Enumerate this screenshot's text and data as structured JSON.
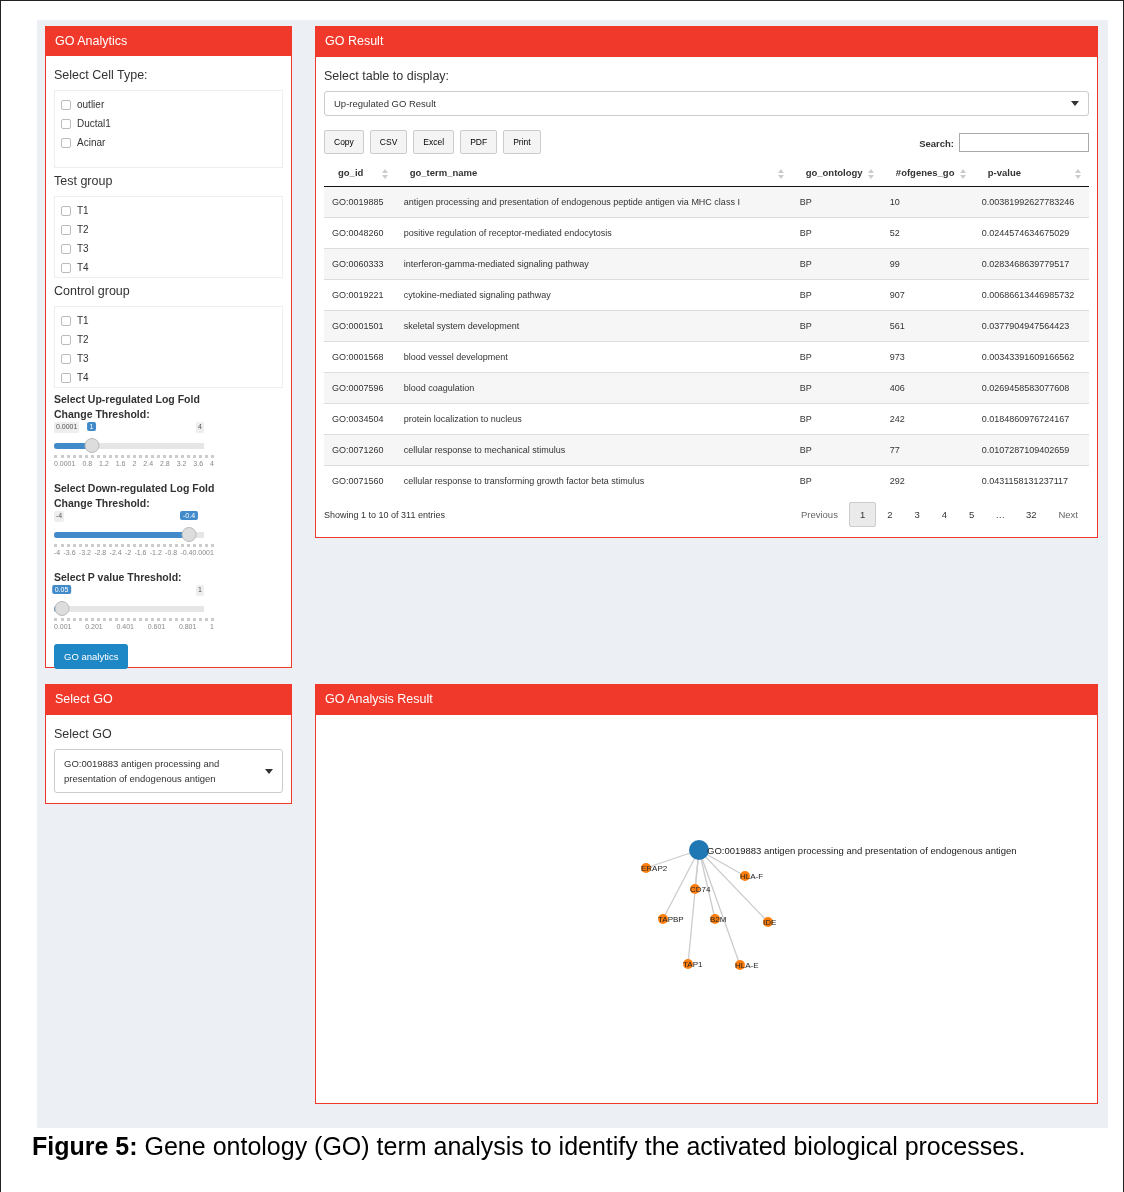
{
  "go_analytics": {
    "title": "GO Analytics",
    "cell_type": {
      "label": "Select Cell Type:",
      "options": [
        {
          "label": "outlier",
          "checked": false
        },
        {
          "label": "Ductal1",
          "checked": false
        },
        {
          "label": "Acinar",
          "checked": false
        }
      ]
    },
    "test_group": {
      "label": "Test group",
      "options": [
        {
          "label": "T1",
          "checked": false
        },
        {
          "label": "T2",
          "checked": false
        },
        {
          "label": "T3",
          "checked": false
        },
        {
          "label": "T4",
          "checked": false
        }
      ]
    },
    "control_group": {
      "label": "Control group",
      "options": [
        {
          "label": "T1",
          "checked": false
        },
        {
          "label": "T2",
          "checked": false
        },
        {
          "label": "T3",
          "checked": false
        },
        {
          "label": "T4",
          "checked": false
        }
      ]
    },
    "sliders": [
      {
        "label": "Select Up-regulated Log Fold Change Threshold:",
        "min_label": "0.0001",
        "max_label": "4",
        "value_label": "1",
        "level": 0.25,
        "ticks": [
          "0.0001",
          "0.8",
          "1.2",
          "1.6",
          "2",
          "2.4",
          "2.8",
          "3.2",
          "3.6",
          "4"
        ]
      },
      {
        "label": "Select Down-regulated Log Fold Change Threshold:",
        "min_label": "-4",
        "value_label": "-0.4",
        "level": 0.9,
        "ticks": [
          "-4",
          "-3.6",
          "-3.2",
          "-2.8",
          "-2.4",
          "-2",
          "-1.6",
          "-1.2",
          "-0.8",
          "-0.40.0001"
        ]
      },
      {
        "label": "Select P value Threshold:",
        "max_label": "1",
        "value_label": "0.05",
        "level": 0.05,
        "ticks": [
          "0.001",
          "0.201",
          "0.401",
          "0.601",
          "0.801",
          "1"
        ]
      }
    ],
    "button": "GO analytics"
  },
  "go_result": {
    "title": "GO Result",
    "select_label": "Select table to display:",
    "select_value": "Up-regulated GO Result",
    "export_buttons": [
      "Copy",
      "CSV",
      "Excel",
      "PDF",
      "Print"
    ],
    "search_label": "Search:",
    "table": {
      "columns": [
        "go_id",
        "go_term_name",
        "go_ontology",
        "#ofgenes_go",
        "p-value"
      ],
      "rows": [
        [
          "GO:0019885",
          "antigen processing and presentation of endogenous peptide antigen via MHC class I",
          "BP",
          "10",
          "0.00381992627783246"
        ],
        [
          "GO:0048260",
          "positive regulation of receptor-mediated endocytosis",
          "BP",
          "52",
          "0.0244574634675029"
        ],
        [
          "GO:0060333",
          "interferon-gamma-mediated signaling pathway",
          "BP",
          "99",
          "0.0283468639779517"
        ],
        [
          "GO:0019221",
          "cytokine-mediated signaling pathway",
          "BP",
          "907",
          "0.00686613446985732"
        ],
        [
          "GO:0001501",
          "skeletal system development",
          "BP",
          "561",
          "0.0377904947564423"
        ],
        [
          "GO:0001568",
          "blood vessel development",
          "BP",
          "973",
          "0.00343391609166562"
        ],
        [
          "GO:0007596",
          "blood coagulation",
          "BP",
          "406",
          "0.0269458583077608"
        ],
        [
          "GO:0034504",
          "protein localization to nucleus",
          "BP",
          "242",
          "0.0184860976724167"
        ],
        [
          "GO:0071260",
          "cellular response to mechanical stimulus",
          "BP",
          "77",
          "0.0107287109402659"
        ],
        [
          "GO:0071560",
          "cellular response to transforming growth factor beta stimulus",
          "BP",
          "292",
          "0.0431158131237117"
        ]
      ]
    },
    "info": "Showing 1 to 10 of 311 entries",
    "pagination": [
      {
        "label": "Previous",
        "kind": "nav"
      },
      {
        "label": "1",
        "kind": "page",
        "selected": true
      },
      {
        "label": "2",
        "kind": "page",
        "selected": false
      },
      {
        "label": "3",
        "kind": "page",
        "selected": false
      },
      {
        "label": "4",
        "kind": "page",
        "selected": false
      },
      {
        "label": "5",
        "kind": "page",
        "selected": false
      },
      {
        "label": "…",
        "kind": "gap"
      },
      {
        "label": "32",
        "kind": "page",
        "selected": false
      },
      {
        "label": "Next",
        "kind": "nav"
      }
    ]
  },
  "select_go": {
    "title": "Select GO",
    "label": "Select GO",
    "value": "GO:0019883 antigen processing and presentation of endogenous antigen"
  },
  "analysis_result": {
    "title": "GO Analysis Result",
    "network": {
      "center": "GO:0019883 antigen processing and presentation of endogenous antigen",
      "genes": [
        "ERAP2",
        "HLA-F",
        "CD74",
        "TAPBP",
        "B2M",
        "IDE",
        "TAP1",
        "HLA-E"
      ]
    }
  },
  "caption": "**Figure 5:** Gene ontology (GO) term analysis to identify the activated biological processes."
}
